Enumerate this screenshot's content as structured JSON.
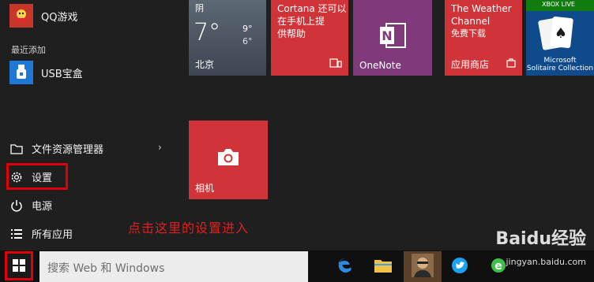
{
  "start_menu": {
    "top_app": {
      "label": "QQ游戏"
    },
    "recent_header": "最近添加",
    "recent_app": {
      "label": "USB宝盒"
    },
    "system_items": [
      {
        "label": "文件资源管理器"
      },
      {
        "label": "设置"
      },
      {
        "label": "电源"
      },
      {
        "label": "所有应用"
      }
    ]
  },
  "tiles": {
    "weather": {
      "condition": "阴",
      "temp": "7°",
      "high": "9°",
      "low": "6°",
      "city": "北京"
    },
    "cortana": {
      "line1": "Cortana 还可以",
      "line2": "在手机上提",
      "line3": "供帮助"
    },
    "onenote": {
      "label": "OneNote"
    },
    "weather_channel": {
      "line1": "The Weather",
      "line2": "Channel",
      "line3": "免费下载",
      "label": "应用商店"
    },
    "solitaire": {
      "badge": "XBOX LIVE",
      "line1": "Microsoft",
      "line2": "Solitaire Collection"
    },
    "camera": {
      "label": "相机"
    }
  },
  "annotation": "点击这里的设置进入",
  "taskbar": {
    "search_placeholder": "搜索 Web 和 Windows"
  },
  "watermark": {
    "brand": "Baidu经验",
    "url": "jingyan.baidu.com"
  },
  "colors": {
    "accent_red": "#d13438",
    "onenote_purple": "#80397b",
    "highlight": "#e0000a"
  }
}
